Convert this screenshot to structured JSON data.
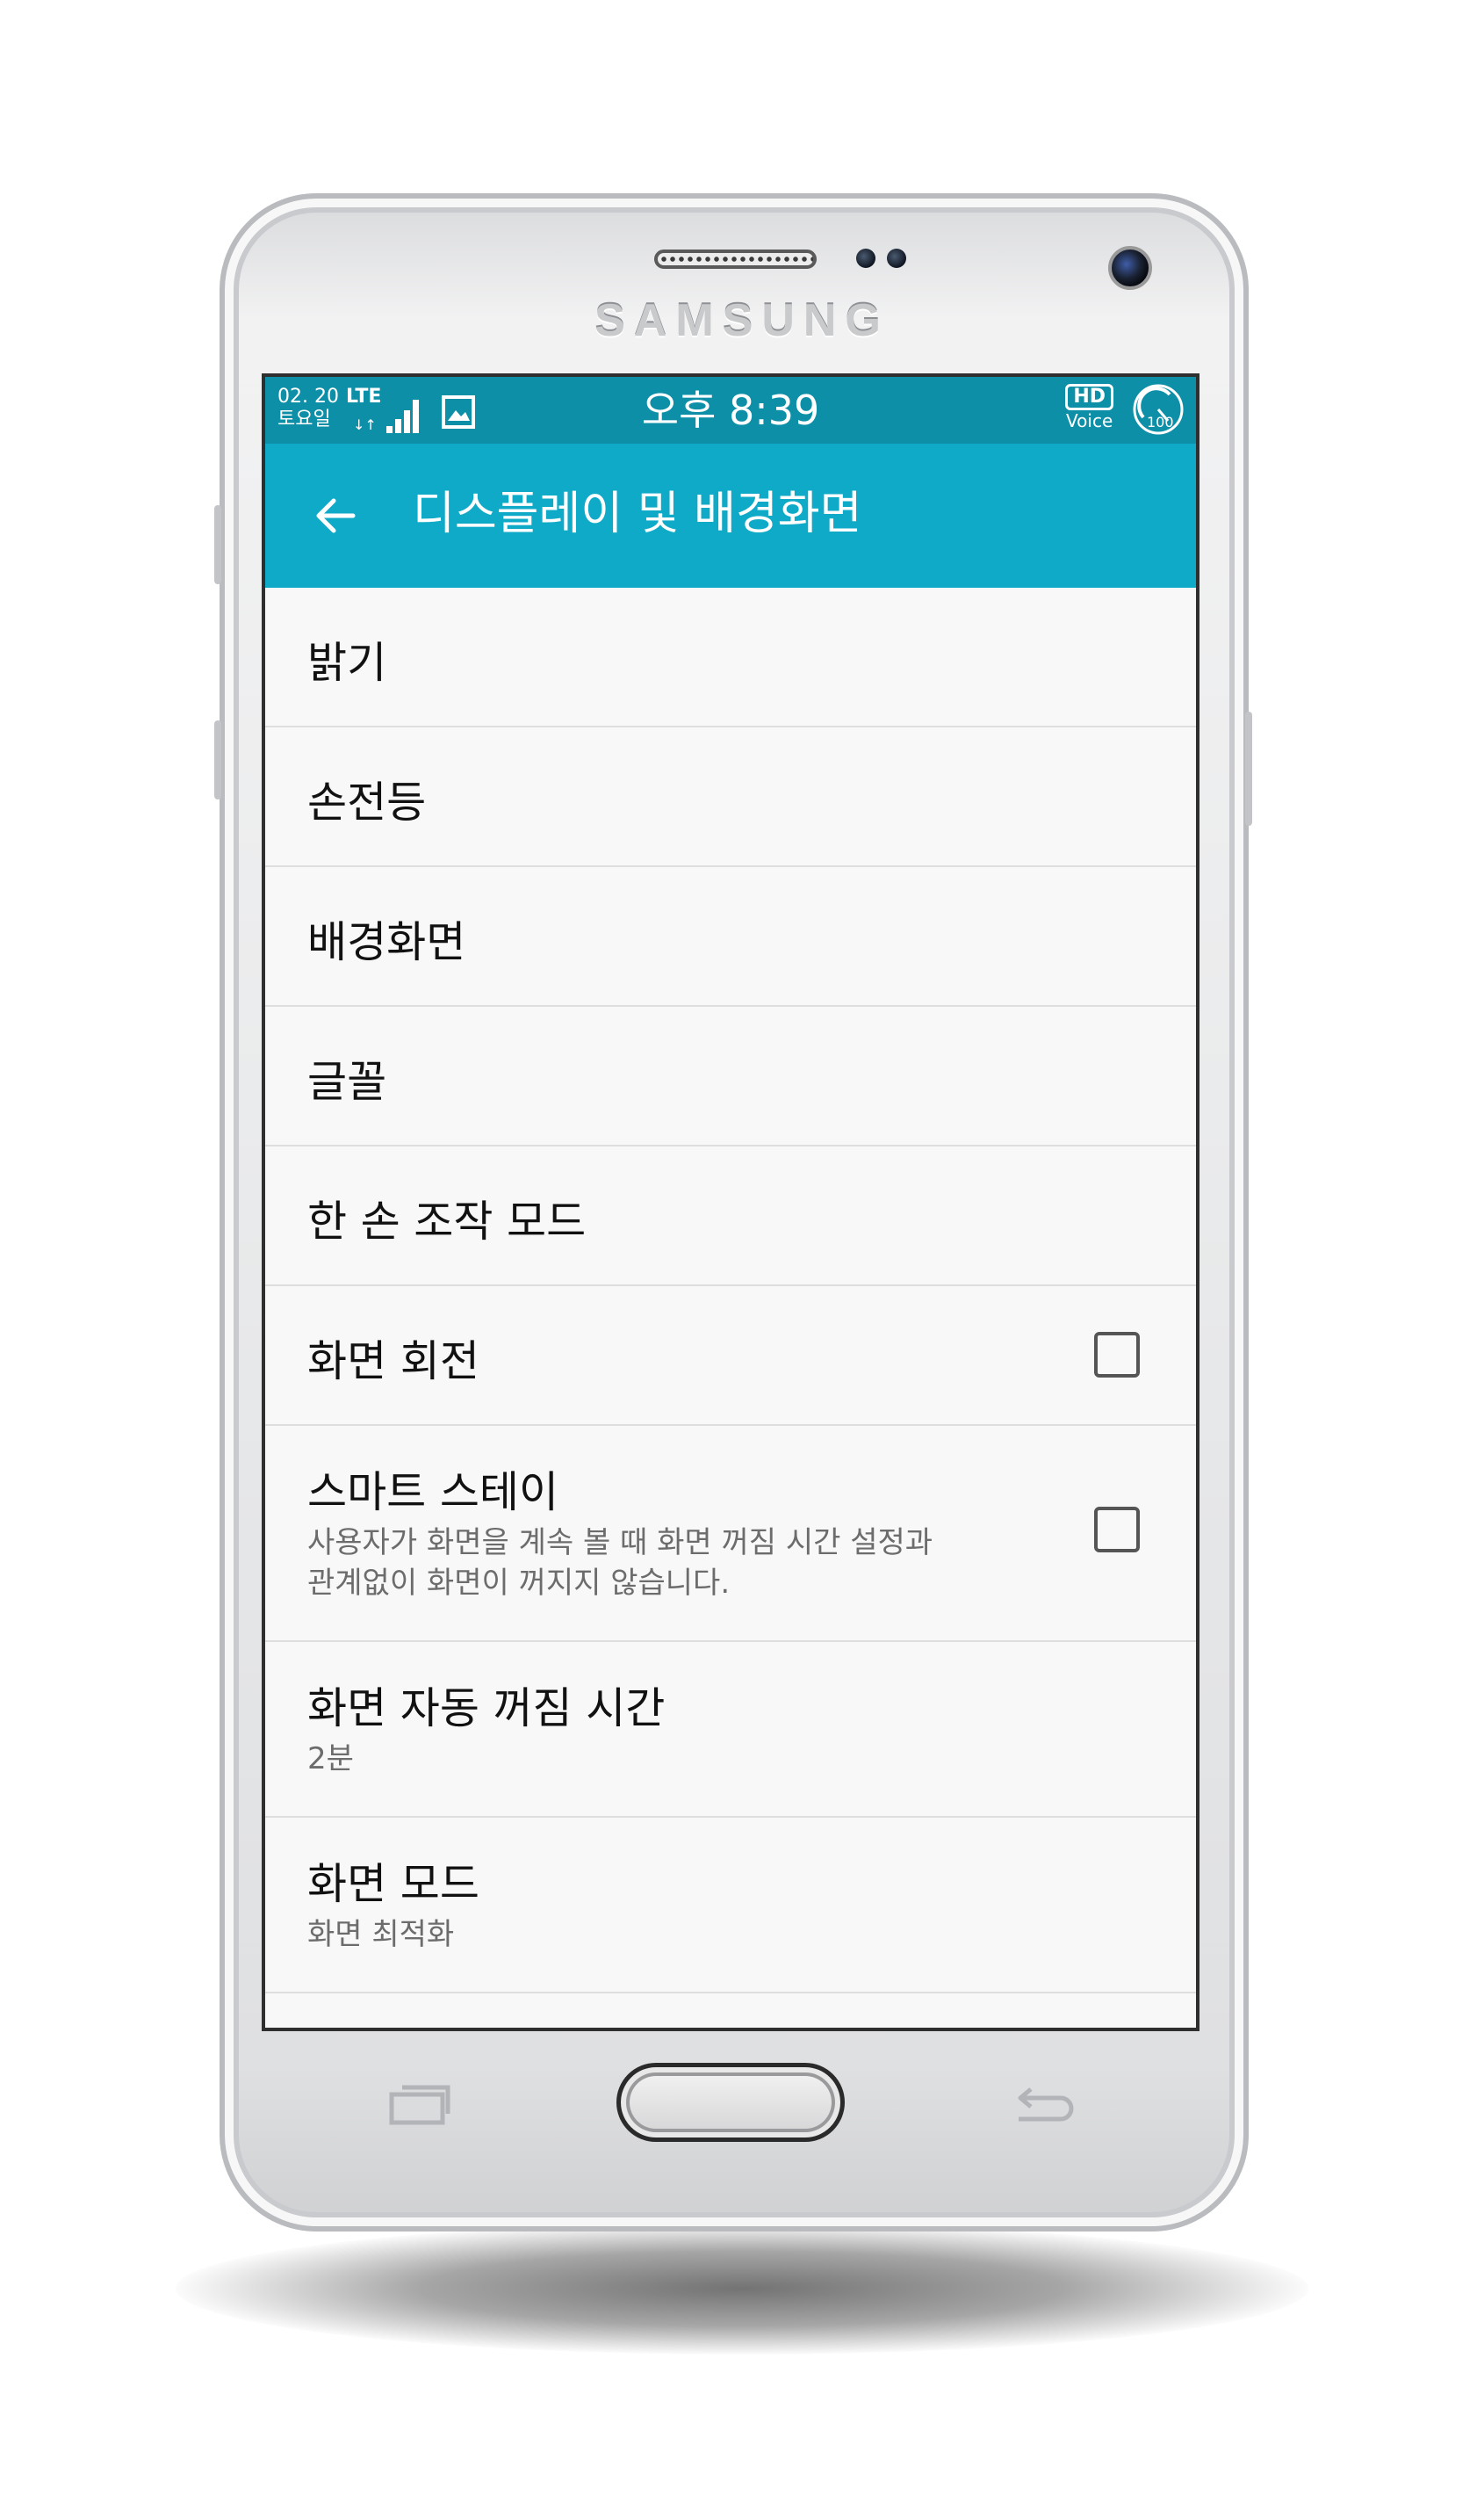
{
  "device": {
    "brand": "SAMSUNG"
  },
  "status_bar": {
    "date": "02. 20",
    "day": "토요일",
    "network": "LTE",
    "time": "오후 8:39",
    "hd": "HD",
    "voice": "Voice",
    "battery": "100"
  },
  "app_bar": {
    "title": "디스플레이 및 배경화면",
    "back_icon": "arrow-left-icon"
  },
  "settings": [
    {
      "title": "밝기"
    },
    {
      "title": "손전등"
    },
    {
      "title": "배경화면"
    },
    {
      "title": "글꼴"
    },
    {
      "title": "한 손 조작 모드"
    },
    {
      "title": "화면 회전",
      "checked": false
    },
    {
      "title": "스마트 스테이",
      "summary_line1": "사용자가 화면을 계속 볼 때 화면 꺼짐 시간 설정과",
      "summary_line2": "관계없이 화면이 꺼지지 않습니다.",
      "checked": false
    },
    {
      "title": "화면 자동 꺼짐 시간",
      "summary": "2분"
    },
    {
      "title": "화면 모드",
      "summary": "화면 최적화"
    }
  ],
  "colors": {
    "status_bar": "#0e8fa8",
    "app_bar": "#10aac9",
    "background": "#f8f8f8"
  }
}
